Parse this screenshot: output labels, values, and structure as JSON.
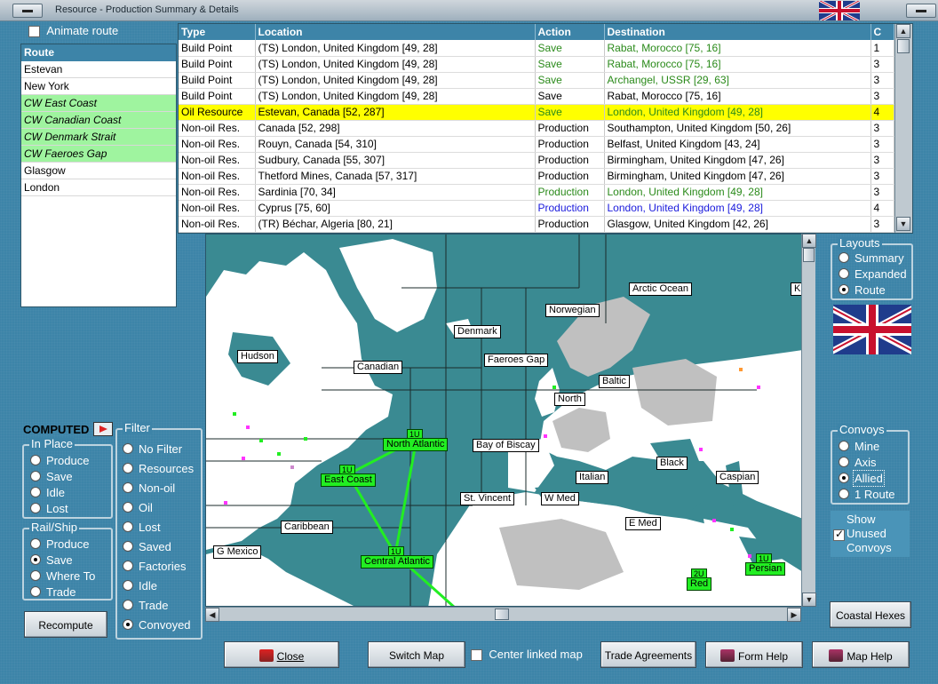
{
  "window": {
    "title": "Resource - Production Summary & Details"
  },
  "animate_route": {
    "label": "Animate route",
    "checked": false
  },
  "route_list": {
    "header": "Route",
    "items": [
      {
        "label": "Estevan",
        "highlight": false
      },
      {
        "label": "New York",
        "highlight": false
      },
      {
        "label": "CW East Coast",
        "highlight": true
      },
      {
        "label": "CW Canadian Coast",
        "highlight": true
      },
      {
        "label": "CW Denmark Strait",
        "highlight": true
      },
      {
        "label": "CW Faeroes Gap",
        "highlight": true
      },
      {
        "label": "Glasgow",
        "highlight": false
      },
      {
        "label": "London",
        "highlight": false
      }
    ]
  },
  "table": {
    "headers": {
      "type": "Type",
      "location": "Location",
      "action": "Action",
      "destination": "Destination",
      "c": "C"
    },
    "rows": [
      {
        "type": "Build Point",
        "location": "(TS) London, United Kingdom [49, 28]",
        "action": "Save",
        "destination": "Rabat, Morocco [75, 16]",
        "c": "1",
        "color": "green",
        "highlight": false
      },
      {
        "type": "Build Point",
        "location": "(TS) London, United Kingdom [49, 28]",
        "action": "Save",
        "destination": "Rabat, Morocco [75, 16]",
        "c": "3",
        "color": "green",
        "highlight": false
      },
      {
        "type": "Build Point",
        "location": "(TS) London, United Kingdom [49, 28]",
        "action": "Save",
        "destination": "Archangel, USSR [29, 63]",
        "c": "3",
        "color": "green",
        "highlight": false
      },
      {
        "type": "Build Point",
        "location": "(TS) London, United Kingdom [49, 28]",
        "action": "Save",
        "destination": "Rabat, Morocco [75, 16]",
        "c": "3",
        "color": "black",
        "highlight": false
      },
      {
        "type": "Oil Resource",
        "location": "Estevan, Canada [52, 287]",
        "action": "Save",
        "destination": "London, United Kingdom [49, 28]",
        "c": "4",
        "color": "green",
        "highlight": true
      },
      {
        "type": "Non-oil Res.",
        "location": "Canada [52, 298]",
        "action": "Production",
        "destination": "Southampton, United Kingdom [50, 26]",
        "c": "3",
        "color": "black",
        "highlight": false
      },
      {
        "type": "Non-oil Res.",
        "location": "Rouyn, Canada [54, 310]",
        "action": "Production",
        "destination": "Belfast, United Kingdom [43, 24]",
        "c": "3",
        "color": "black",
        "highlight": false
      },
      {
        "type": "Non-oil Res.",
        "location": "Sudbury, Canada [55, 307]",
        "action": "Production",
        "destination": "Birmingham, United Kingdom [47, 26]",
        "c": "3",
        "color": "black",
        "highlight": false
      },
      {
        "type": "Non-oil Res.",
        "location": "Thetford Mines, Canada [57, 317]",
        "action": "Production",
        "destination": "Birmingham, United Kingdom [47, 26]",
        "c": "3",
        "color": "black",
        "highlight": false
      },
      {
        "type": "Non-oil Res.",
        "location": "Sardinia [70, 34]",
        "action": "Production",
        "destination": "London, United Kingdom [49, 28]",
        "c": "3",
        "color": "green",
        "highlight": false
      },
      {
        "type": "Non-oil Res.",
        "location": "Cyprus [75, 60]",
        "action": "Production",
        "destination": "London, United Kingdom [49, 28]",
        "c": "4",
        "color": "blue",
        "highlight": false
      },
      {
        "type": "Non-oil Res.",
        "location": "(TR) Béchar, Algeria [80, 21]",
        "action": "Production",
        "destination": "Glasgow, United Kingdom [42, 26]",
        "c": "3",
        "color": "black",
        "highlight": false
      }
    ]
  },
  "map": {
    "sea_labels": {
      "arctic": "Arctic Ocean",
      "k": "K",
      "norwegian": "Norwegian",
      "denmark": "Denmark",
      "hudson": "Hudson",
      "canadian": "Canadian",
      "faeroes": "Faeroes Gap",
      "baltic": "Baltic",
      "north": "North",
      "bay_biscay": "Bay of Biscay",
      "black": "Black",
      "italian": "Italian",
      "caspian": "Caspian",
      "st_vincent": "St. Vincent",
      "w_med": "W Med",
      "e_med": "E Med",
      "caribbean": "Caribbean",
      "g_mexico": "G Mexico"
    },
    "convoy_labels": {
      "north_atlantic": "North Atlantic",
      "east_coast": "East Coast",
      "central_atlantic": "Central Atlantic",
      "red": "Red",
      "persian": "Persian"
    },
    "convoy_badges": {
      "north_atlantic": "1U",
      "east_coast": "1U",
      "central_atlantic": "1U",
      "red": "2U",
      "persian": "1U"
    },
    "colors": {
      "sea": "#3a8a92",
      "land": "#ffffff",
      "neutral": "#c0c0c0",
      "route": "#22ee22"
    }
  },
  "layouts": {
    "title": "Layouts",
    "options": [
      "Summary",
      "Expanded",
      "Route"
    ],
    "selected": "Route"
  },
  "convoys": {
    "title": "Convoys",
    "options": [
      "Mine",
      "Axis",
      "Allied",
      "1 Route"
    ],
    "selected": "Allied"
  },
  "show_unused": {
    "label_line1": "Show",
    "label_line2": "Unused",
    "label_line3": "Convoys",
    "checked": true
  },
  "coastal_hexes_button": "Coastal Hexes",
  "computed": {
    "label": "COMPUTED"
  },
  "in_place": {
    "title": "In Place",
    "options": [
      "Produce",
      "Save",
      "Idle",
      "Lost"
    ],
    "selected": null
  },
  "rail_ship": {
    "title": "Rail/Ship",
    "options": [
      "Produce",
      "Save",
      "Where To",
      "Trade"
    ],
    "selected": "Save"
  },
  "filter": {
    "title": "Filter",
    "options": [
      "No Filter",
      "Resources",
      "Non-oil",
      "Oil",
      "Lost",
      "Saved",
      "Factories",
      "Idle",
      "Trade",
      "Convoyed"
    ],
    "selected": "Convoyed"
  },
  "buttons": {
    "recompute": "Recompute",
    "close": "Close",
    "switch_map": "Switch Map",
    "center_linked_map": "Center linked map",
    "trade_agreements": "Trade Agreements",
    "form_help": "Form Help",
    "map_help": "Map Help"
  }
}
